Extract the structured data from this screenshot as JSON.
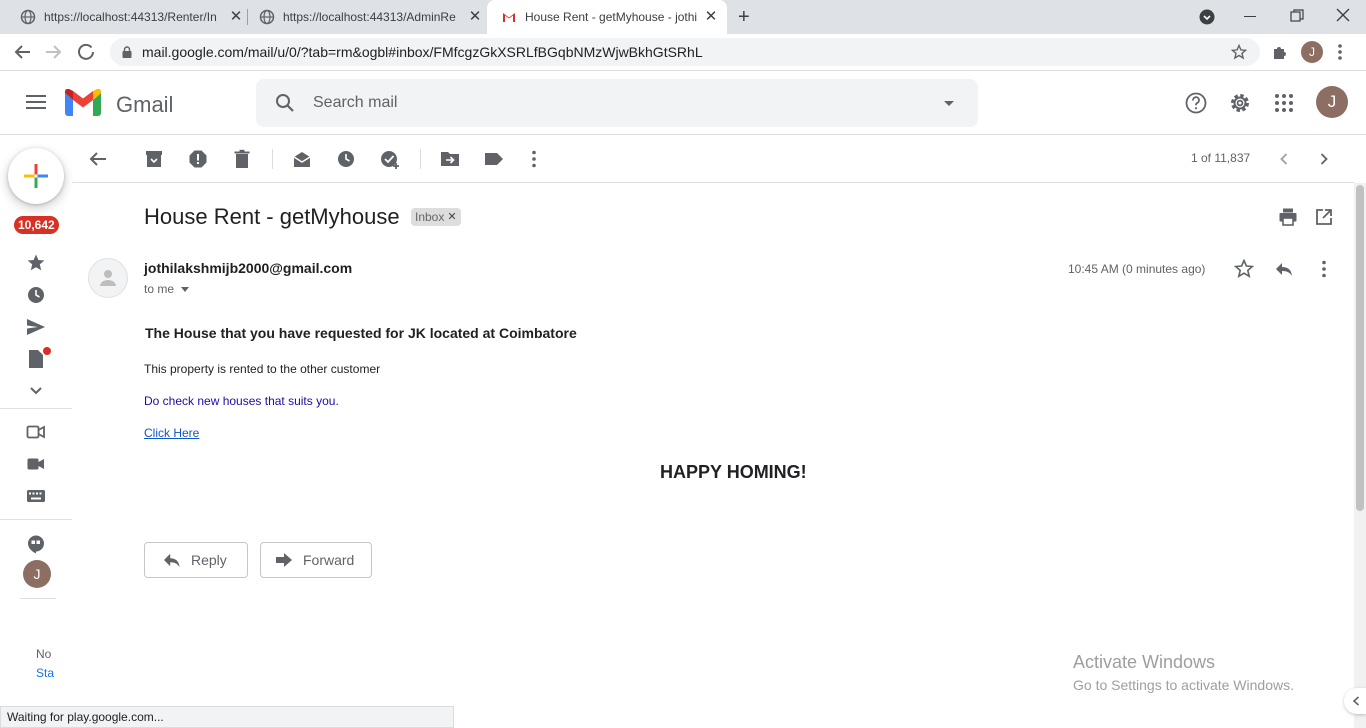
{
  "browser": {
    "tabs": [
      {
        "title": "https://localhost:44313/Renter/In",
        "active": false
      },
      {
        "title": "https://localhost:44313/AdminRe",
        "active": false
      },
      {
        "title": "House Rent - getMyhouse - jothi",
        "active": true
      }
    ],
    "url": "mail.google.com/mail/u/0/?tab=rm&ogbl#inbox/FMfcgzGkXSRLfBGqbNMzWjwBkhGtSRhL",
    "profile_initial": "J"
  },
  "gmail": {
    "app_name": "Gmail",
    "search_placeholder": "Search mail",
    "account_initial": "J",
    "colors": {
      "badge": "#d93025",
      "link": "#1a0dab",
      "avatar": "#8d6e63"
    }
  },
  "rail": {
    "inbox_count": "10,642",
    "chat_avatar_initial": "J",
    "bottom_text_1": "No",
    "bottom_text_2": "Sta"
  },
  "toolbar": {
    "counter": "1 of 11,837"
  },
  "message": {
    "subject": "House Rent - getMyhouse",
    "label": "Inbox",
    "sender": "jothilakshmijb2000@gmail.com",
    "recipient": "to me",
    "time": "10:45 AM (0 minutes ago)",
    "body": {
      "heading": "The House that you have requested for JK located at Coimbatore",
      "paragraph": "This property is rented to the other customer",
      "link_text": "Do check new houses that suits you.",
      "anchor": "Click Here",
      "closing": "HAPPY HOMING!"
    },
    "reply_label": "Reply",
    "forward_label": "Forward"
  },
  "watermark": {
    "line1": "Activate Windows",
    "line2": "Go to Settings to activate Windows."
  },
  "status_bar": "Waiting for play.google.com..."
}
